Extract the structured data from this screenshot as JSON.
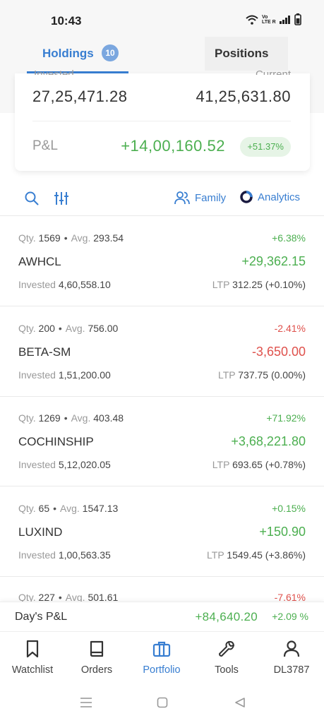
{
  "status": {
    "time": "10:43",
    "signal_label": "Vo LTE R"
  },
  "tabs": {
    "holdings_label": "Holdings",
    "holdings_count": "10",
    "positions_label": "Positions"
  },
  "summary": {
    "invested_label": "Invested",
    "current_label": "Current",
    "invested": "27,25,471.28",
    "current": "41,25,631.80",
    "pnl_label": "P&L",
    "pnl": "+14,00,160.52",
    "pnl_pct": "+51.37%"
  },
  "toolbar": {
    "family_label": "Family",
    "analytics_label": "Analytics"
  },
  "labels": {
    "qty": "Qty.",
    "avg": "Avg.",
    "invested": "Invested",
    "ltp": "LTP"
  },
  "holdings": [
    {
      "qty": "1569",
      "avg": "293.54",
      "symbol": "AWHCL",
      "pct": "+6.38%",
      "pnl": "+29,362.15",
      "invested": "4,60,558.10",
      "ltp": "312.25",
      "ltp_change": "(+0.10%)",
      "trend": "up"
    },
    {
      "qty": "200",
      "avg": "756.00",
      "symbol": "BETA-SM",
      "pct": "-2.41%",
      "pnl": "-3,650.00",
      "invested": "1,51,200.00",
      "ltp": "737.75",
      "ltp_change": "(0.00%)",
      "trend": "down"
    },
    {
      "qty": "1269",
      "avg": "403.48",
      "symbol": "COCHINSHIP",
      "pct": "+71.92%",
      "pnl": "+3,68,221.80",
      "invested": "5,12,020.05",
      "ltp": "693.65",
      "ltp_change": "(+0.78%)",
      "trend": "up"
    },
    {
      "qty": "65",
      "avg": "1547.13",
      "symbol": "LUXIND",
      "pct": "+0.15%",
      "pnl": "+150.90",
      "invested": "1,00,563.35",
      "ltp": "1549.45",
      "ltp_change": "(+3.86%)",
      "trend": "up"
    }
  ],
  "partial_holding": {
    "qty": "227",
    "avg": "501.61",
    "pct": "-7.61%"
  },
  "days_pnl": {
    "label": "Day's P&L",
    "value": "+84,640.20",
    "pct": "+2.09 %"
  },
  "nav": {
    "watchlist": "Watchlist",
    "orders": "Orders",
    "portfolio": "Portfolio",
    "tools": "Tools",
    "profile": "DL3787"
  },
  "colors": {
    "accent": "#387ed1",
    "positive": "#4caf50",
    "negative": "#df514c"
  }
}
